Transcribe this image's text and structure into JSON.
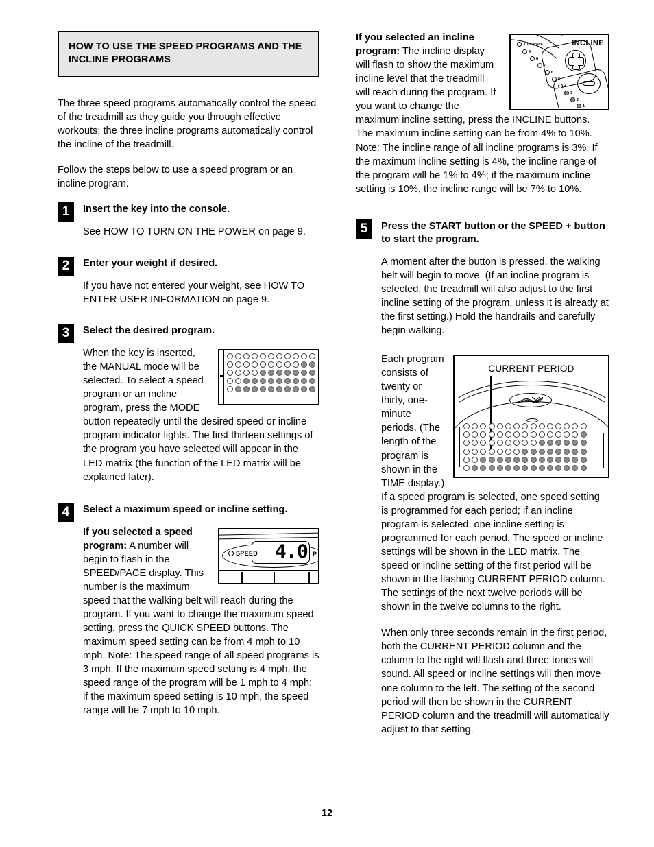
{
  "page": {
    "number": "12",
    "title": "HOW TO USE THE SPEED PROGRAMS AND THE INCLINE PROGRAMS"
  },
  "left_column": {
    "intro_paragraph_1": "The three speed programs automatically control the speed of the treadmill as they guide you through effective workouts; the three incline programs automatically control the incline of the treadmill.",
    "intro_paragraph_2": "Follow the steps below to use a speed program or an incline program.",
    "steps": [
      {
        "number": "1",
        "title": "Insert the key into the console.",
        "body": "See HOW TO TURN ON THE POWER on page 9."
      },
      {
        "number": "2",
        "title": "Enter your weight if desired.",
        "body": "If you have not entered your weight, see HOW TO ENTER USER INFORMATION on page 9."
      },
      {
        "number": "3",
        "title": "Select the desired program.",
        "body": "When the key is inserted, the MANUAL mode will be selected. To select a speed program or an incline program, press the MODE button repeatedly until the desired speed or incline program indicator lights. The first thirteen settings of the program you have selected will appear in the LED matrix (the function of the LED matrix will be explained later)."
      },
      {
        "number": "4",
        "title": "Select a maximum speed or incline setting.",
        "lead_bold": "If you selected a speed program:",
        "body": " A number will begin to flash in the SPEED/PACE display. This number is the maximum speed that the walking belt will reach during the program. If you want to change the maximum speed setting, press the QUICK SPEED buttons. The maximum speed setting can be from 4 mph to 10 mph. Note: The speed range of all speed programs is 3 mph. If the maximum speed setting is 4 mph, the speed range of the program will be 1 mph to 4 mph; if the maximum speed setting is 10 mph, the speed range will be 7 mph to 10 mph."
      }
    ]
  },
  "right_column": {
    "incline_lead_bold": "If you selected an incline program:",
    "incline_paragraph": " The incline display will flash to show the maximum incline level that the treadmill will reach during the program. If you want to change the maximum incline setting, press the INCLINE buttons. The maximum incline setting can be from 4% to 10%. Note: The incline range of all incline programs is 3%. If the maximum incline setting is 4%, the incline range of the program will be 1% to 4%; if the maximum incline setting is 10%, the incline range will be 7% to 10%.",
    "step5": {
      "number": "5",
      "title": "Press the START button or the SPEED + button to start the program.",
      "paragraph_1": "A moment after the button is pressed, the walking belt will begin to move. (If an incline program is selected, the treadmill will also adjust to the first incline setting of the program, unless it is already at the first setting.) Hold the handrails and carefully begin walking.",
      "paragraph_2": "Each program consists of twenty or thirty, one-minute periods. (The length of the program is shown in the TIME display.) If a speed program is selected, one speed setting is programmed for each period; if an incline program is selected, one incline setting is programmed for each period. The speed or incline settings will be shown in the LED matrix. The speed or incline setting of the first period will be shown in the flashing CURRENT PERIOD column. The settings of the next twelve periods will be shown in the twelve columns to the right.",
      "paragraph_3": "When only three seconds remain in the first period, both the CURRENT PERIOD column and the column to the right will flash and three tones will sound. All speed or incline settings will then move one column to the left. The setting of the second period will then be shown in the CURRENT PERIOD column and the treadmill will automatically adjust to that setting."
    }
  },
  "figures": {
    "speed_display": {
      "indicator_label": "SPEED",
      "value": "4.0",
      "pace_label": "P"
    },
    "incline_panel": {
      "title": "INCLINE",
      "grade_label": "10% grade",
      "levels": [
        "9",
        "8",
        "7",
        "6",
        "5",
        "4",
        "3",
        "2",
        "1"
      ],
      "lit_levels": [
        "3",
        "2",
        "1"
      ]
    },
    "current_period": {
      "caption": "CURRENT PERIOD"
    },
    "led_matrix_small": {
      "columns": 11,
      "rows": 5,
      "lit_counts": [
        0,
        1,
        2,
        2,
        3,
        3,
        3,
        3,
        3,
        4,
        4
      ]
    },
    "led_matrix_large": {
      "columns": 15,
      "rows": 6,
      "lit_counts": [
        0,
        1,
        2,
        2,
        2,
        2,
        2,
        3,
        3,
        4,
        4,
        4,
        4,
        4,
        5
      ]
    }
  },
  "colors": {
    "banner_fill": "#e6e6e6",
    "led_on": "#8c8c8c",
    "ink": "#000000"
  }
}
